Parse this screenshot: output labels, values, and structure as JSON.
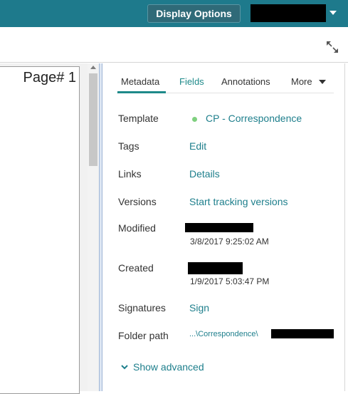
{
  "header": {
    "display_options_label": "Display Options"
  },
  "viewer": {
    "page_label": "Page# 1"
  },
  "tabs": [
    {
      "label": "Metadata"
    },
    {
      "label": "Fields"
    },
    {
      "label": "Annotations"
    },
    {
      "label": "More"
    }
  ],
  "metadata": {
    "template_label": "Template",
    "template_value": "CP - Correspondence",
    "tags_label": "Tags",
    "tags_value": "Edit",
    "links_label": "Links",
    "links_value": "Details",
    "versions_label": "Versions",
    "versions_value": "Start tracking versions",
    "modified_label": "Modified",
    "modified_date": "3/8/2017 9:25:02 AM",
    "created_label": "Created",
    "created_date": "1/9/2017 5:03:47 PM",
    "signatures_label": "Signatures",
    "signatures_value": "Sign",
    "folder_label": "Folder path",
    "folder_value": "...\\Correspondence\\",
    "show_advanced_label": "Show advanced"
  },
  "colors": {
    "header_bg": "#1e7a8c",
    "link": "#1e7f8c",
    "template_dot": "#7fd07f"
  },
  "icons": {
    "expand": "expand-arrows-icon",
    "user_menu": "caret-down-icon",
    "more": "caret-down-icon",
    "advanced": "chevron-down-icon"
  }
}
